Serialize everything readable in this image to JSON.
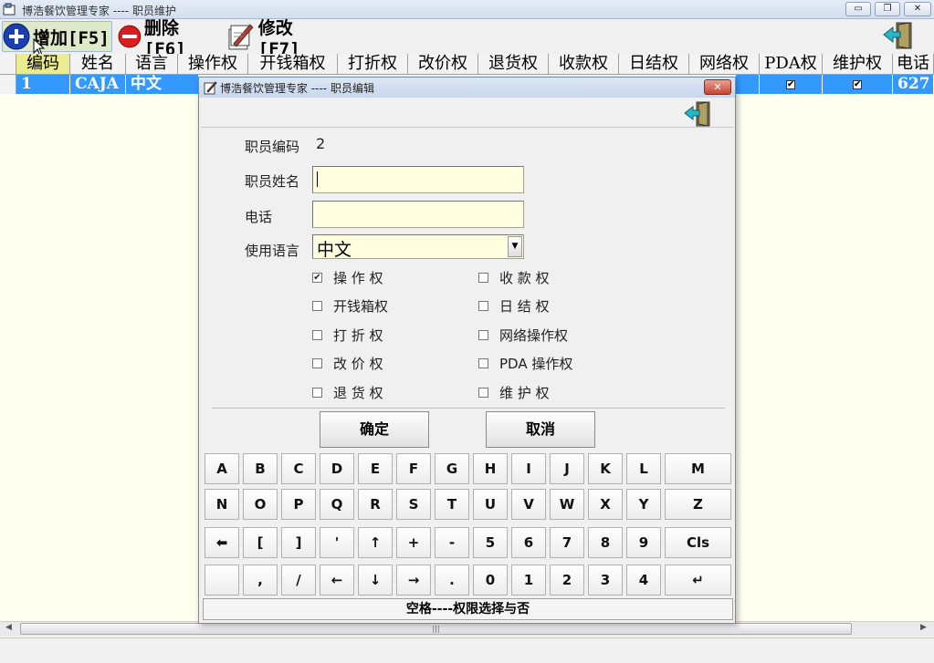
{
  "window": {
    "title": "博浩餐饮管理专家 ---- 职员维护",
    "minimize_label": "▭",
    "restore_label": "❐",
    "close_label": "✕"
  },
  "toolbar": {
    "add_label": "增加[F5]",
    "delete_label": "删除[F6]",
    "edit_label": "修改[F7]"
  },
  "grid": {
    "columns": [
      "编码",
      "姓名",
      "语言",
      "操作权",
      "开钱箱权",
      "打折权",
      "改价权",
      "退货权",
      "收款权",
      "日结权",
      "网络权",
      "PDA权",
      "维护权",
      "电话"
    ],
    "row": {
      "code": "1",
      "name": "CAJA",
      "language": "中文",
      "pda_checked": "✔",
      "maint_checked": "✔",
      "phone": "627"
    }
  },
  "dialog": {
    "title": "博浩餐饮管理专家 ---- 职员编辑",
    "close_label": "✕",
    "fields": {
      "code_label": "职员编码",
      "code_value": "2",
      "name_label": "职员姓名",
      "name_value": "",
      "phone_label": "电话",
      "phone_value": "",
      "language_label": "使用语言",
      "language_value": "中文"
    },
    "permissions": [
      {
        "label": "操 作 权",
        "checked": "✔"
      },
      {
        "label": "开钱箱权",
        "checked": ""
      },
      {
        "label": "打 折 权",
        "checked": ""
      },
      {
        "label": "改 价 权",
        "checked": ""
      },
      {
        "label": "退 货 权",
        "checked": ""
      },
      {
        "label": "收 款 权",
        "checked": ""
      },
      {
        "label": "日 结 权",
        "checked": ""
      },
      {
        "label": "网络操作权",
        "checked": ""
      },
      {
        "label": "PDA 操作权",
        "checked": ""
      },
      {
        "label": "维 护 权",
        "checked": ""
      }
    ],
    "ok_label": "确定",
    "cancel_label": "取消",
    "keyboard": {
      "row1": [
        "A",
        "B",
        "C",
        "D",
        "E",
        "F",
        "G",
        "H",
        "I",
        "J",
        "K",
        "L",
        "M"
      ],
      "row2": [
        "N",
        "O",
        "P",
        "Q",
        "R",
        "S",
        "T",
        "U",
        "V",
        "W",
        "X",
        "Y",
        "Z"
      ],
      "row3": [
        "⬅",
        "[",
        "]",
        "'",
        "↑",
        "+",
        "-",
        "5",
        "6",
        "7",
        "8",
        "9",
        "Cls"
      ],
      "row4": [
        "",
        ",",
        "/",
        "←",
        "↓",
        "→",
        ".",
        "0",
        "1",
        "2",
        "3",
        "4",
        "↵"
      ]
    },
    "footer_text": "空格----权限选择与否"
  },
  "colors": {
    "selection": "#3399ff",
    "grid_background": "#fffff0",
    "input_background": "#ffffdf"
  }
}
